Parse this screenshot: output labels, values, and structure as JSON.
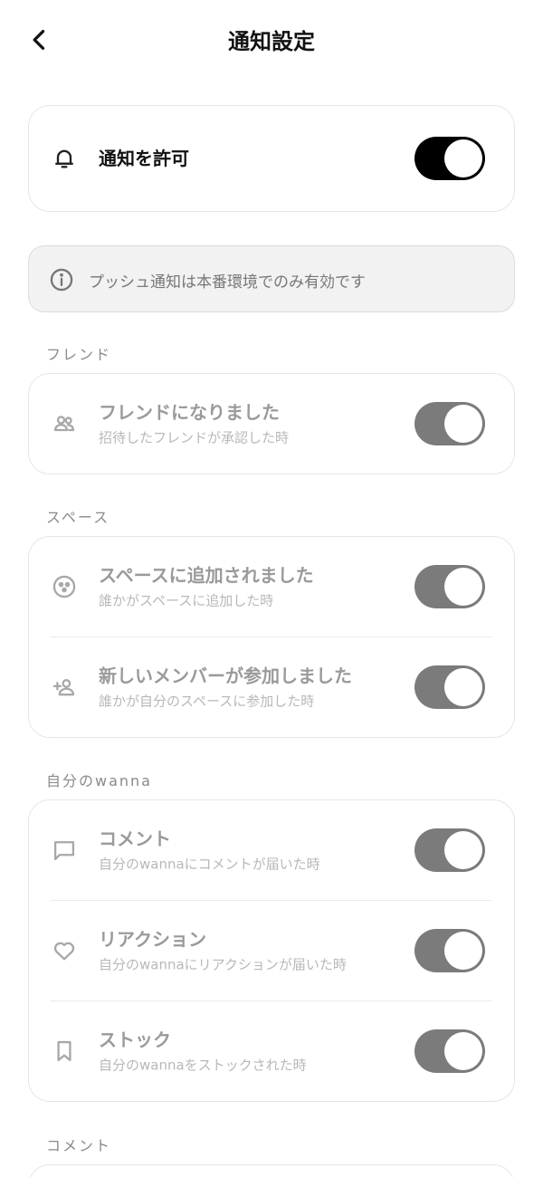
{
  "header": {
    "title": "通知設定",
    "back_icon": "chevron-left-icon"
  },
  "master": {
    "title": "通知を許可",
    "icon": "bell-icon",
    "enabled": true
  },
  "info": {
    "icon": "info-icon",
    "text": "プッシュ通知は本番環境でのみ有効です"
  },
  "sections": {
    "friend": {
      "label": "フレンド",
      "items": [
        {
          "title": "フレンドになりました",
          "subtitle": "招待したフレンドが承認した時",
          "icon": "people-icon",
          "enabled": true
        }
      ]
    },
    "space": {
      "label": "スペース",
      "items": [
        {
          "title": "スペースに追加されました",
          "subtitle": "誰かがスペースに追加した時",
          "icon": "space-icon",
          "enabled": true
        },
        {
          "title": "新しいメンバーが参加しました",
          "subtitle": "誰かが自分のスペースに参加した時",
          "icon": "person-add-icon",
          "enabled": true
        }
      ]
    },
    "wanna": {
      "label": "自分のwanna",
      "items": [
        {
          "title": "コメント",
          "subtitle": "自分のwannaにコメントが届いた時",
          "icon": "comment-icon",
          "enabled": true
        },
        {
          "title": "リアクション",
          "subtitle": "自分のwannaにリアクションが届いた時",
          "icon": "heart-icon",
          "enabled": true
        },
        {
          "title": "ストック",
          "subtitle": "自分のwannaをストックされた時",
          "icon": "bookmark-icon",
          "enabled": true
        }
      ]
    },
    "comment": {
      "label": "コメント"
    }
  },
  "colors": {
    "toggle_on_master": "#000000",
    "toggle_on_disabled": "#7b7b7b"
  }
}
